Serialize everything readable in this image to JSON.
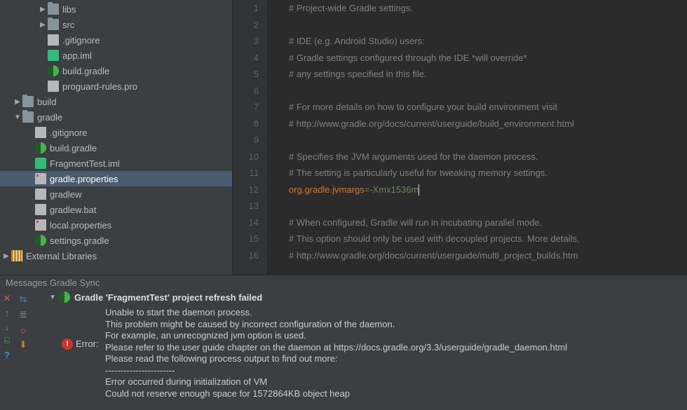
{
  "tree": {
    "items": [
      {
        "indent": 54,
        "exp": "▶",
        "icon": "folder",
        "label": "libs"
      },
      {
        "indent": 54,
        "exp": "▶",
        "icon": "folder",
        "label": "src"
      },
      {
        "indent": 54,
        "exp": "",
        "icon": "file",
        "label": ".gitignore"
      },
      {
        "indent": 54,
        "exp": "",
        "icon": "iml",
        "label": "app.iml"
      },
      {
        "indent": 54,
        "exp": "",
        "icon": "gradle",
        "label": "build.gradle"
      },
      {
        "indent": 54,
        "exp": "",
        "icon": "file",
        "label": "proguard-rules.pro"
      },
      {
        "indent": 18,
        "exp": "▶",
        "icon": "folder",
        "label": "build"
      },
      {
        "indent": 18,
        "exp": "▼",
        "icon": "folder",
        "label": "gradle"
      },
      {
        "indent": 36,
        "exp": "",
        "icon": "file",
        "label": ".gitignore"
      },
      {
        "indent": 36,
        "exp": "",
        "icon": "gradle",
        "label": "build.gradle"
      },
      {
        "indent": 36,
        "exp": "",
        "icon": "iml",
        "label": "FragmentTest.iml"
      },
      {
        "indent": 36,
        "exp": "",
        "icon": "props",
        "label": "gradle.properties",
        "selected": true
      },
      {
        "indent": 36,
        "exp": "",
        "icon": "file",
        "label": "gradlew"
      },
      {
        "indent": 36,
        "exp": "",
        "icon": "file",
        "label": "gradlew.bat"
      },
      {
        "indent": 36,
        "exp": "",
        "icon": "props",
        "label": "local.properties"
      },
      {
        "indent": 36,
        "exp": "",
        "icon": "gradle",
        "label": "settings.gradle"
      },
      {
        "indent": 2,
        "exp": "▶",
        "icon": "lib",
        "label": "External Libraries"
      }
    ]
  },
  "editor": {
    "lines": [
      {
        "n": 1,
        "t": "comment",
        "s": "# Project-wide Gradle settings."
      },
      {
        "n": 2,
        "t": "comment",
        "s": ""
      },
      {
        "n": 3,
        "t": "comment",
        "s": "# IDE (e.g. Android Studio) users:"
      },
      {
        "n": 4,
        "t": "comment",
        "s": "# Gradle settings configured through the IDE *will override*"
      },
      {
        "n": 5,
        "t": "comment",
        "s": "# any settings specified in this file."
      },
      {
        "n": 6,
        "t": "comment",
        "s": ""
      },
      {
        "n": 7,
        "t": "comment",
        "s": "# For more details on how to configure your build environment visit"
      },
      {
        "n": 8,
        "t": "comment",
        "s": "# http://www.gradle.org/docs/current/userguide/build_environment.html"
      },
      {
        "n": 9,
        "t": "comment",
        "s": ""
      },
      {
        "n": 10,
        "t": "comment",
        "s": "# Specifies the JVM arguments used for the daemon process."
      },
      {
        "n": 11,
        "t": "comment",
        "s": "# The setting is particularly useful for tweaking memory settings."
      },
      {
        "n": 12,
        "t": "prop",
        "k": "org.gradle.jvmargs",
        "v": "=-Xmx1536m"
      },
      {
        "n": 13,
        "t": "comment",
        "s": ""
      },
      {
        "n": 14,
        "t": "comment",
        "s": "# When configured, Gradle will run in incubating parallel mode."
      },
      {
        "n": 15,
        "t": "comment",
        "s": "# This option should only be used with decoupled projects. More details,"
      },
      {
        "n": 16,
        "t": "comment",
        "s": "# http://www.gradle.org/docs/current/userguide/multi_project_builds.htm"
      }
    ]
  },
  "messages": {
    "tab_label": "Messages Gradle Sync",
    "title": "Gradle 'FragmentTest' project refresh failed",
    "error_label": "Error:",
    "lines": [
      "Unable to start the daemon process.",
      "This problem might be caused by incorrect configuration of the daemon.",
      "For example, an unrecognized jvm option is used.",
      "Please refer to the user guide chapter on the daemon at https://docs.gradle.org/3.3/userguide/gradle_daemon.html",
      "Please read the following process output to find out more:",
      "-----------------------",
      "Error occurred during initialization of VM",
      "Could not reserve enough space for 1572864KB object heap"
    ]
  },
  "tool_icons": {
    "close": "✕",
    "collapse": "⇆",
    "up": "↑",
    "down": "↓",
    "export": "⍇",
    "help": "?",
    "a": "≣",
    "b": "☼",
    "c": "⬇"
  }
}
